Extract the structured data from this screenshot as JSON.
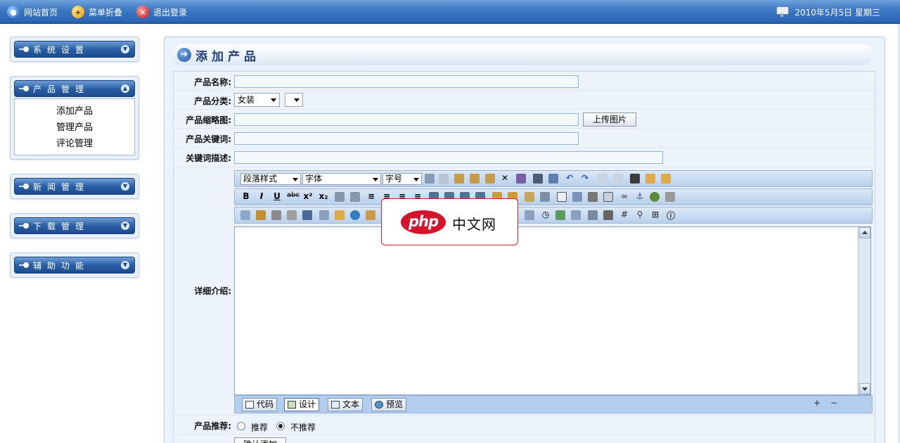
{
  "topnav": {
    "home": "网站首页",
    "collapse": "菜单折叠",
    "logout": "退出登录",
    "date": "2010年5月5日 星期三"
  },
  "sidebar": {
    "panels": [
      {
        "label": "系统设置",
        "expanded": false
      },
      {
        "label": "产品管理",
        "expanded": true,
        "items": [
          "添加产品",
          "管理产品",
          "评论管理"
        ]
      },
      {
        "label": "新闻管理",
        "expanded": false
      },
      {
        "label": "下载管理",
        "expanded": false
      },
      {
        "label": "辅助功能",
        "expanded": false
      }
    ]
  },
  "main": {
    "title": "添加产品",
    "form": {
      "name_label": "产品名称:",
      "category_label": "产品分类:",
      "category_value": "女装",
      "subcategory_value": "",
      "thumb_label": "产品缩略图:",
      "upload_button": "上传图片",
      "keywords_label": "产品关键词:",
      "desc_label": "关键词描述:",
      "detail_label": "详细介绍:",
      "recommend_label": "产品推荐:",
      "recommend_yes": "推荐",
      "recommend_no": "不推荐",
      "recommend_selected": "不推荐",
      "submit_partial": "确认添加"
    },
    "editor": {
      "paragraph_style": "段落样式",
      "font": "字体",
      "font_size": "字号",
      "modes": [
        "代码",
        "设计",
        "文本",
        "预览"
      ],
      "active_mode": "设计"
    }
  },
  "watermark": {
    "logo": "php",
    "text": "中文网"
  },
  "colors": {
    "topbar": "#3d78c4",
    "panel_head": "#2a5fa6",
    "main_bg": "#eaf2fb",
    "watermark_red": "#d7132c"
  }
}
